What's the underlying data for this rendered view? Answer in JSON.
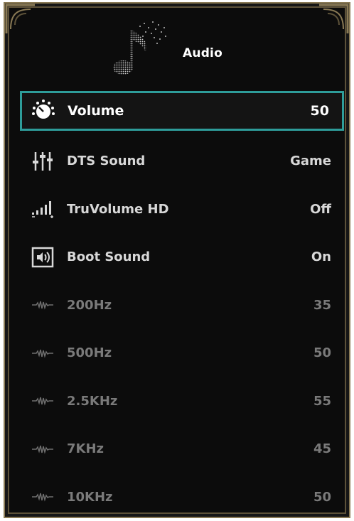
{
  "header": {
    "title": "Audio",
    "icon": "music-note-icon"
  },
  "menu": {
    "items": [
      {
        "label": "Volume",
        "value": "50",
        "icon": "volume-knob-icon",
        "state": "selected"
      },
      {
        "label": "DTS Sound",
        "value": "Game",
        "icon": "equalizer-sliders-icon",
        "state": "normal"
      },
      {
        "label": "TruVolume HD",
        "value": "Off",
        "icon": "signal-bars-icon",
        "state": "normal"
      },
      {
        "label": "Boot Sound",
        "value": "On",
        "icon": "speaker-box-icon",
        "state": "normal"
      },
      {
        "label": "200Hz",
        "value": "35",
        "icon": "waveform-icon",
        "state": "disabled"
      },
      {
        "label": "500Hz",
        "value": "50",
        "icon": "waveform-icon",
        "state": "disabled"
      },
      {
        "label": "2.5KHz",
        "value": "55",
        "icon": "waveform-icon",
        "state": "disabled"
      },
      {
        "label": "7KHz",
        "value": "45",
        "icon": "waveform-icon",
        "state": "disabled"
      },
      {
        "label": "10KHz",
        "value": "50",
        "icon": "waveform-icon",
        "state": "disabled"
      }
    ]
  },
  "colors": {
    "accent": "#2e9d9a",
    "frame": "#8a7a55",
    "background": "#0c0c0c",
    "dim_text": "#7a7a7a"
  }
}
